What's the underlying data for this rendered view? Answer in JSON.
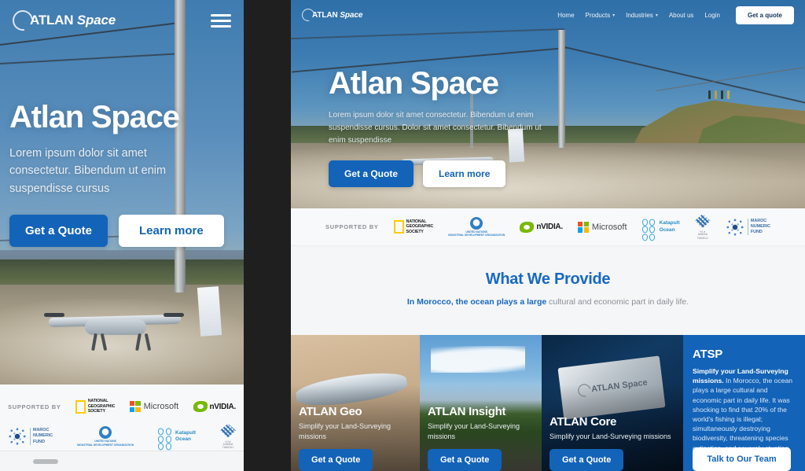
{
  "brand": {
    "name_bold": "ATLAN",
    "name_italic": "Space",
    "accent_blue": "#1363b8",
    "heading_blue": "#1769c4"
  },
  "mobile": {
    "logo_bold": "ATLAN",
    "logo_italic": "Space",
    "menu_icon": "hamburger-icon",
    "hero": {
      "title": "Atlan Space",
      "subtitle": "Lorem ipsum dolor sit amet consectetur. Bibendum ut enim suspendisse cursus",
      "primary_button": "Get a Quote",
      "secondary_button": "Learn more"
    },
    "supported": {
      "label": "SUPPORTED BY",
      "row1": [
        {
          "name": "National Geographic Society",
          "lines": "NATIONAL\nGEOGRAPHIC\nSOCIETY"
        },
        {
          "name": "Microsoft",
          "label": "Microsoft"
        },
        {
          "name": "NVIDIA",
          "label": "nVIDIA."
        }
      ],
      "row2": [
        {
          "name": "Maroc Numeric Fund",
          "lines": "MAROC\nNUMERIC\nFUND"
        },
        {
          "name": "United Nations Industrial Development Organization",
          "lines": "UNITED NATIONS\nINDUSTRIAL DEVELOPMENT ORGANIZATION"
        },
        {
          "name": "Katapult Ocean",
          "lines": "Katapult\nOcean"
        },
        {
          "name": "Arabic partner logo",
          "lines": "وزارة التربية\nJAMIAA\nTAMOUJ"
        }
      ]
    }
  },
  "desktop": {
    "logo_bold": "ATLAN",
    "logo_italic": "Space",
    "nav": [
      {
        "label": "Home",
        "has_caret": false
      },
      {
        "label": "Products",
        "has_caret": true
      },
      {
        "label": "Industries",
        "has_caret": true
      },
      {
        "label": "About us",
        "has_caret": false
      },
      {
        "label": "Login",
        "has_caret": false
      }
    ],
    "nav_cta": "Get a quote",
    "hero": {
      "title": "Atlan Space",
      "subtitle": "Lorem ipsum dolor sit amet consectetur. Bibendum ut enim suspendisse cursus. Dolor sit amet consectetur. Bibendum ut enim suspendisse",
      "primary_button": "Get a Quote",
      "secondary_button": "Learn more"
    },
    "supported": {
      "label": "SUPPORTED BY",
      "logos": [
        {
          "name": "National Geographic Society",
          "lines": "NATIONAL\nGEOGRAPHIC\nSOCIETY"
        },
        {
          "name": "United Nations Industrial Development Organization",
          "lines": "UNITED NATIONS\nINDUSTRIAL DEVELOPMENT ORGANIZATION"
        },
        {
          "name": "NVIDIA",
          "label": "nVIDIA."
        },
        {
          "name": "Microsoft",
          "label": "Microsoft"
        },
        {
          "name": "Katapult Ocean",
          "lines": "Katapult\nOcean"
        },
        {
          "name": "Arabic partner logo",
          "lines": "وزارة التربية\nJAMIAA\nTAMOUJ"
        },
        {
          "name": "Maroc Numeric Fund",
          "lines": "MAROC\nNUMERIC\nFUND"
        }
      ]
    },
    "provide": {
      "heading": "What We Provide",
      "sub_bold": "In Morocco, the ocean plays a large",
      "sub_rest": " cultural and economic part in daily life."
    },
    "cards": [
      {
        "id": "geo",
        "title": "ATLAN Geo",
        "desc": "Simplify your Land-Surveying missions",
        "button": "Get a Quote"
      },
      {
        "id": "insight",
        "title": "ATLAN Insight",
        "desc": "Simplify your Land-Surveying missions",
        "button": "Get a Quote"
      },
      {
        "id": "core",
        "title": "ATLAN Core",
        "desc": "Simplify your Land-Surveying missions",
        "button": "Get a Quote",
        "chip_label": "ATLAN Space"
      },
      {
        "id": "atsp",
        "title": "ATSP",
        "desc_bold": "Simplify your Land-Surveying missions.",
        "desc_rest": " In Morocco, the ocean plays a large cultural and economic part in daily life. It was shocking to find that 20% of the world's fishing is illegal; simultaneously destroying biodiversity, threatening species extinction, and severely stunting third-world economies.",
        "button": "Talk to Our Team"
      }
    ]
  }
}
